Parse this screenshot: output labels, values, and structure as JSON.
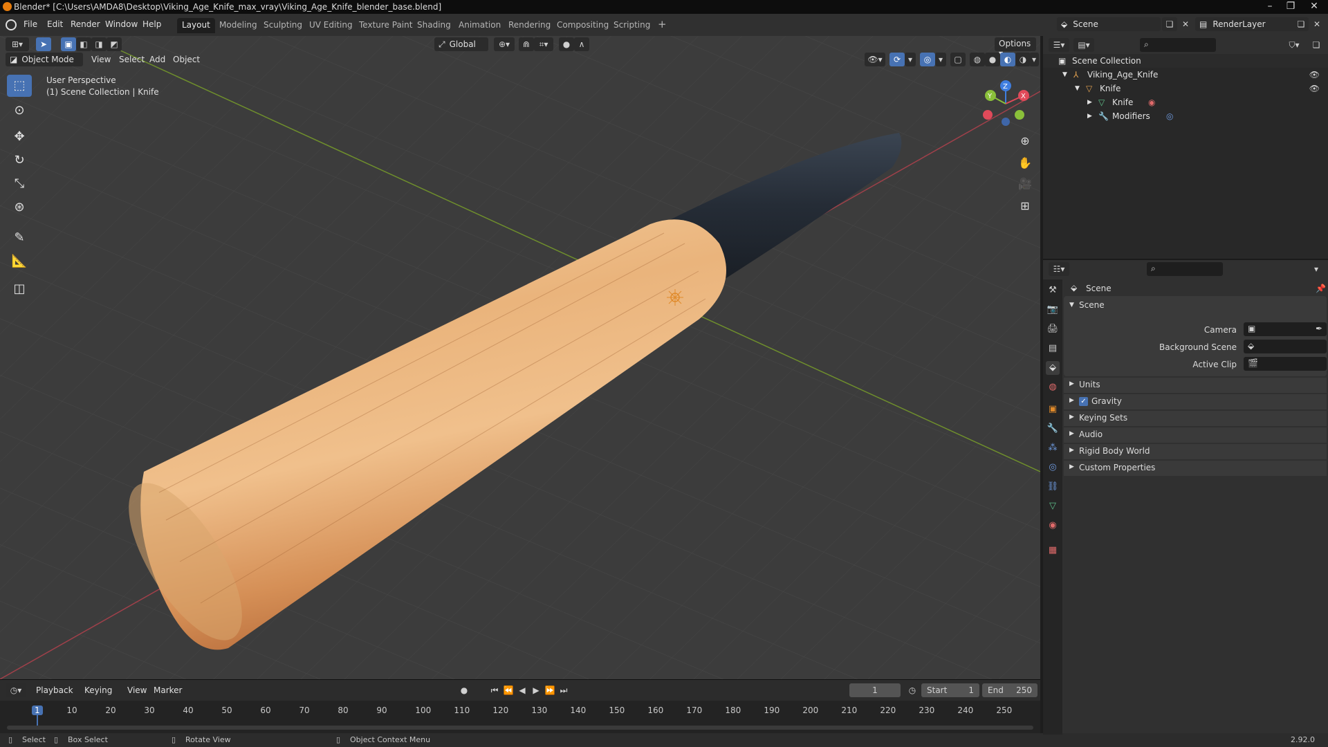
{
  "window": {
    "title": "Blender* [C:\\Users\\AMDA8\\Desktop\\Viking_Age_Knife_max_vray\\Viking_Age_Knife_blender_base.blend]"
  },
  "menu": [
    "File",
    "Edit",
    "Render",
    "Window",
    "Help"
  ],
  "workspaces": [
    "Layout",
    "Modeling",
    "Sculpting",
    "UV Editing",
    "Texture Paint",
    "Shading",
    "Animation",
    "Rendering",
    "Compositing",
    "Scripting"
  ],
  "workspace_add": "+",
  "scene_selector": {
    "label": "Scene"
  },
  "view_layer_selector": {
    "label": "RenderLayer"
  },
  "viewport": {
    "transform_orientation": "Global",
    "options_label": "Options",
    "mode": "Object Mode",
    "menus": [
      "View",
      "Select",
      "Add",
      "Object"
    ],
    "perspective_label": "User Perspective",
    "collection_label": "(1) Scene Collection | Knife",
    "gizmo_axes": {
      "x": "X",
      "y": "Y",
      "z": "Z"
    }
  },
  "outliner": {
    "root": "Scene Collection",
    "items": [
      {
        "label": "Viking_Age_Knife",
        "level": 1
      },
      {
        "label": "Knife",
        "level": 2
      },
      {
        "label": "Knife",
        "level": 3
      },
      {
        "label": "Modifiers",
        "level": 3
      }
    ]
  },
  "properties": {
    "context_title": "Scene",
    "panel_title": "Scene",
    "fields": [
      {
        "label": "Camera"
      },
      {
        "label": "Background Scene"
      },
      {
        "label": "Active Clip"
      }
    ],
    "subpanels": [
      "Units",
      "Gravity",
      "Keying Sets",
      "Audio",
      "Rigid Body World",
      "Custom Properties"
    ],
    "gravity_enabled": true
  },
  "timeline": {
    "menus": [
      "Playback",
      "Keying",
      "View",
      "Marker"
    ],
    "current_frame": "1",
    "start_label": "Start",
    "start_value": "1",
    "end_label": "End",
    "end_value": "250",
    "ticks": [
      "1",
      "10",
      "20",
      "30",
      "40",
      "50",
      "60",
      "70",
      "80",
      "90",
      "100",
      "110",
      "120",
      "130",
      "140",
      "150",
      "160",
      "170",
      "180",
      "190",
      "200",
      "210",
      "220",
      "230",
      "240",
      "250"
    ]
  },
  "statusbar": {
    "items": [
      "Select",
      "Box Select",
      "Rotate View",
      "Object Context Menu"
    ],
    "version": "2.92.0"
  },
  "colors": {
    "accent": "#4772b3",
    "axis_x": "#e04a5a",
    "axis_y": "#8ac03a",
    "axis_z": "#3f7ee0",
    "wood_light": "#f2c590",
    "wood_dark": "#c98850",
    "blade": "#2a3340"
  }
}
